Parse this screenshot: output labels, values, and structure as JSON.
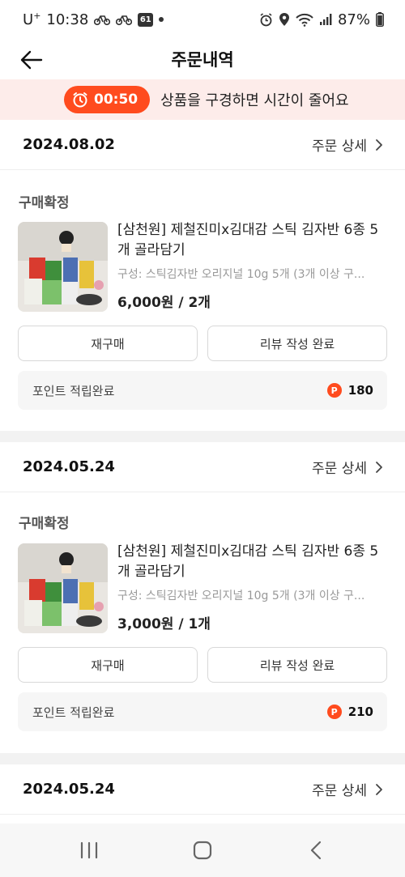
{
  "status_bar": {
    "carrier": "U",
    "carrier_sup": "+",
    "time": "10:38",
    "badge": "61",
    "battery": "87%"
  },
  "header": {
    "title": "주문내역"
  },
  "timer_banner": {
    "timer": "00:50",
    "text": "상품을 구경하면 시간이 줄어요",
    "accent_color": "#ff4b1e",
    "bg_color": "#fdecea"
  },
  "orders": [
    {
      "date": "2024.08.02",
      "detail_link": "주문 상세",
      "status": "구매확정",
      "product_name": "[삼천원] 제철진미x김대감 스틱 김자반 6종 5개 골라담기",
      "option": "구성: 스틱김자반 오리지널 10g 5개 (3개 이상 구...",
      "price": "6,000원 / 2개",
      "rebuy_label": "재구매",
      "review_label": "리뷰 작성 완료",
      "point_label": "포인트 적립완료",
      "point_value": "180"
    },
    {
      "date": "2024.05.24",
      "detail_link": "주문 상세",
      "status": "구매확정",
      "product_name": "[삼천원] 제철진미x김대감 스틱 김자반 6종 5개 골라담기",
      "option": "구성: 스틱김자반 오리지널 10g 5개 (3개 이상 구...",
      "price": "3,000원 / 1개",
      "rebuy_label": "재구매",
      "review_label": "리뷰 작성 완료",
      "point_label": "포인트 적립완료",
      "point_value": "210"
    },
    {
      "date": "2024.05.24",
      "detail_link": "주문 상세"
    }
  ],
  "point_icon": "P"
}
